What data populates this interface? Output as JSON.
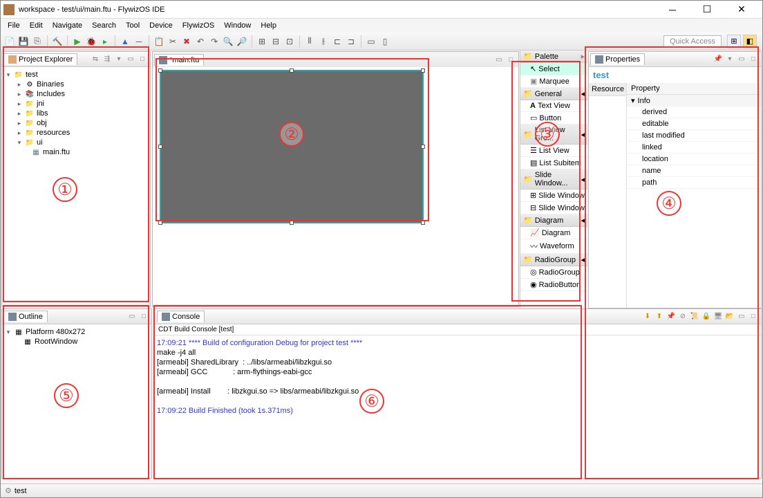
{
  "title": "workspace - test/ui/main.ftu - FlywizOS IDE",
  "menus": [
    "File",
    "Edit",
    "Navigate",
    "Search",
    "Tool",
    "Device",
    "FlywizOS",
    "Window",
    "Help"
  ],
  "quick_access": "Quick Access",
  "project_explorer": {
    "title": "Project Explorer",
    "root": "test",
    "items": [
      "Binaries",
      "Includes",
      "jni",
      "libs",
      "obj",
      "resources",
      "ui"
    ],
    "file": "main.ftu"
  },
  "editor": {
    "tab": "*main.ftu"
  },
  "palette": {
    "title": "Palette",
    "tools": [
      "Select",
      "Marquee"
    ],
    "categories": [
      {
        "name": "General",
        "items": [
          "Text View",
          "Button"
        ]
      },
      {
        "name": "List View Gro...",
        "items": [
          "List View",
          "List Subitem"
        ]
      },
      {
        "name": "Slide Window...",
        "items": [
          "Slide Window",
          "Slide Window"
        ]
      },
      {
        "name": "Diagram",
        "items": [
          "Diagram",
          "Waveform"
        ]
      },
      {
        "name": "RadioGroup",
        "items": [
          "RadioGroup",
          "RadioButton"
        ]
      }
    ]
  },
  "properties": {
    "title": "Properties",
    "resource_label": "test",
    "left_tab": "Resource",
    "header": "Property",
    "group": "Info",
    "rows": [
      "derived",
      "editable",
      "last modified",
      "linked",
      "location",
      "name",
      "path"
    ]
  },
  "outline": {
    "title": "Outline",
    "platform": "Platform 480x272",
    "root": "RootWindow"
  },
  "console": {
    "title": "Console",
    "subtitle": "CDT Build Console [test]",
    "line1": "17:09:21 **** Build of configuration Debug for project test ****",
    "line2": "make -j4 all ",
    "line3": "[armeabi] SharedLibrary  : ../libs/armeabi/libzkgui.so",
    "line4": "[armeabi] GCC            : arm-flythings-eabi-gcc",
    "line5": "",
    "line6": "[armeabi] Install        : libzkgui.so => libs/armeabi/libzkgui.so",
    "line7": "",
    "line8": "17:09:22 Build Finished (took 1s.371ms)"
  },
  "statusbar": "test"
}
